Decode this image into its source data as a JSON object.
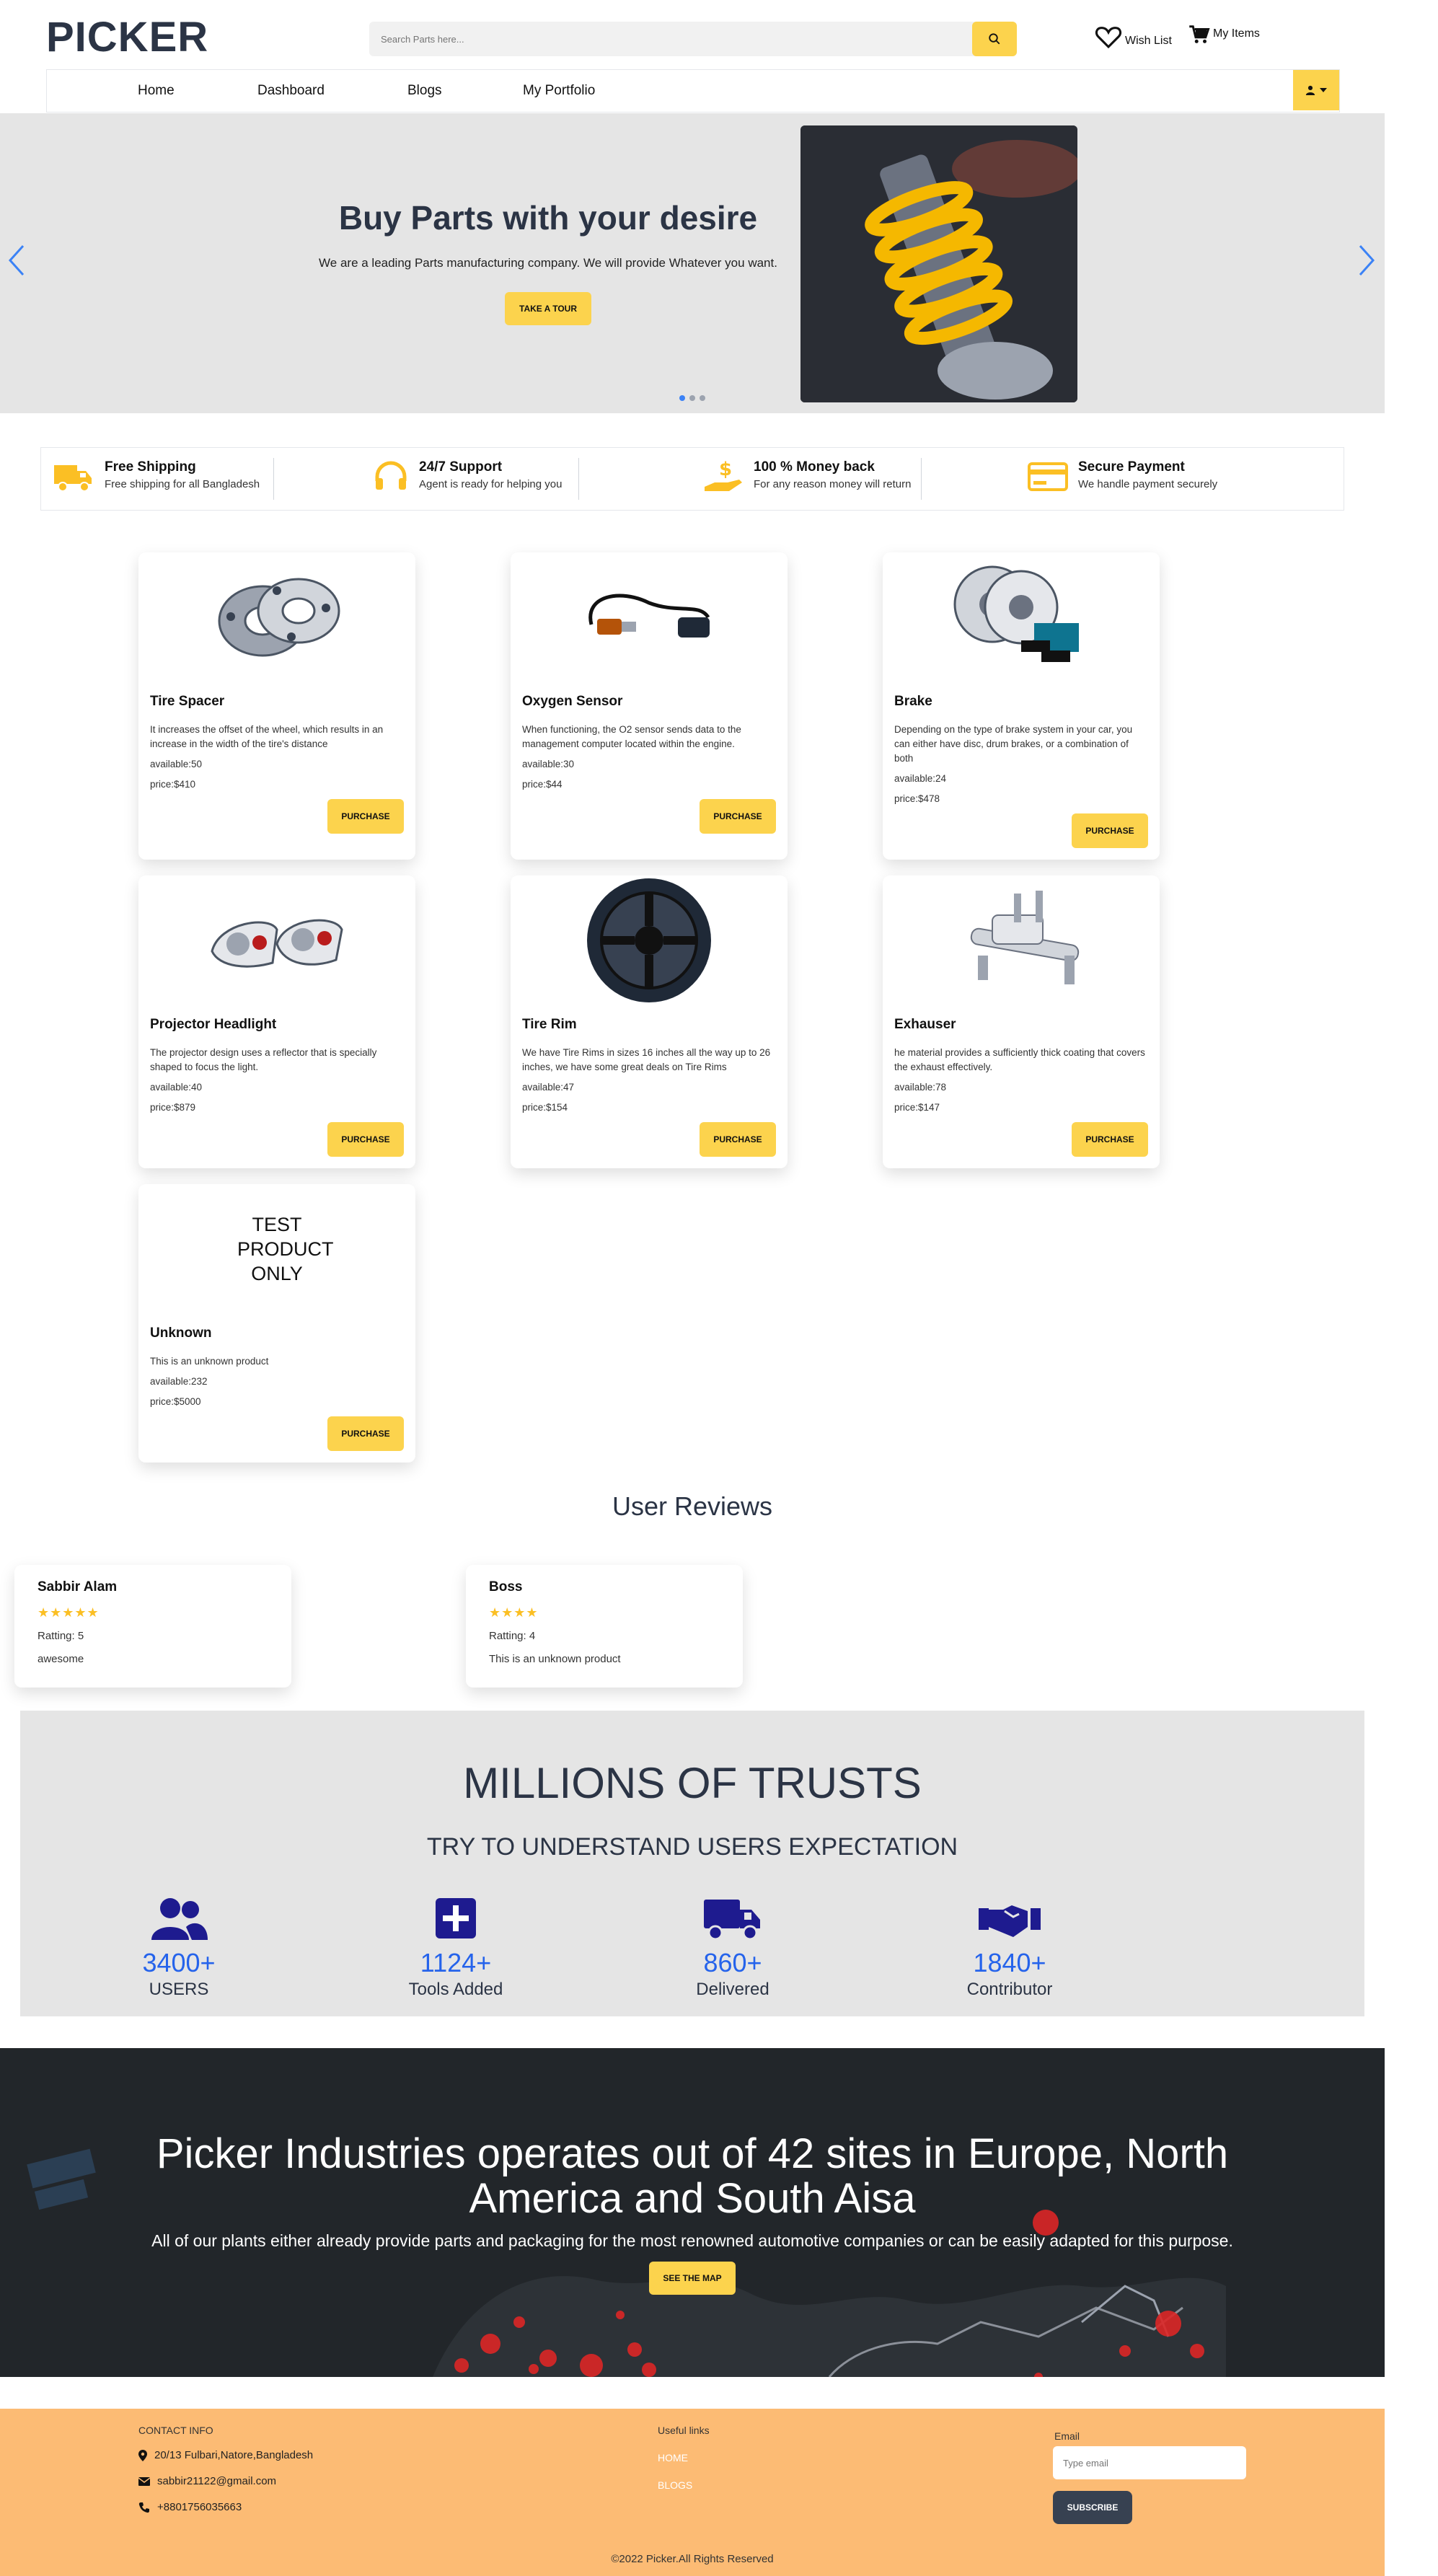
{
  "header": {
    "logo": "PICKER",
    "search_placeholder": "Search Parts here...",
    "wishlist_label": "Wish List",
    "myitems_label": "My Items"
  },
  "nav": {
    "items": [
      "Home",
      "Dashboard",
      "Blogs",
      "My Portfolio"
    ]
  },
  "hero": {
    "title": "Buy Parts with your desire",
    "subtitle": "We are a leading Parts manufacturing company. We will provide Whatever you want.",
    "button": "TAKE A TOUR",
    "active_slide": 1,
    "slide_count": 3
  },
  "features": [
    {
      "icon": "truck-icon",
      "title": "Free Shipping",
      "subtitle": "Free shipping for all Bangladesh"
    },
    {
      "icon": "headphones-icon",
      "title": "24/7 Support",
      "subtitle": "Agent is ready for helping you"
    },
    {
      "icon": "money-hand-icon",
      "title": "100 % Money back",
      "subtitle": "For any reason money will return"
    },
    {
      "icon": "credit-card-icon",
      "title": "Secure Payment",
      "subtitle": "We handle payment securely"
    }
  ],
  "products": [
    {
      "name": "Tire Spacer",
      "description": "It increases the offset of the wheel, which results in an increase in the width of the tire's distance",
      "available": "available:50",
      "price": "price:$410",
      "button": "PURCHASE",
      "image": "tire-spacer-image"
    },
    {
      "name": "Oxygen Sensor",
      "description": "When functioning, the O2 sensor sends data to the management computer located within the engine.",
      "available": "available:30",
      "price": "price:$44",
      "button": "PURCHASE",
      "image": "oxygen-sensor-image"
    },
    {
      "name": "Brake",
      "description": "Depending on the type of brake system in your car, you can either have disc, drum brakes, or a combination of both",
      "available": "available:24",
      "price": "price:$478",
      "button": "PURCHASE",
      "image": "brake-image"
    },
    {
      "name": "Projector Headlight",
      "description": "The projector design uses a reflector that is specially shaped to focus the light.",
      "available": "available:40",
      "price": "price:$879",
      "button": "PURCHASE",
      "image": "headlight-image"
    },
    {
      "name": "Tire Rim",
      "description": "We have Tire Rims in sizes 16 inches all the way up to 26 inches, we have some great deals on Tire Rims",
      "available": "available:47",
      "price": "price:$154",
      "button": "PURCHASE",
      "image": "tire-rim-image"
    },
    {
      "name": "Exhauser",
      "description": "he material provides a sufficiently thick coating that covers the exhaust effectively.",
      "available": "available:78",
      "price": "price:$147",
      "button": "PURCHASE",
      "image": "exhauser-image"
    },
    {
      "name": "Unknown",
      "description": "This is an unknown product",
      "available": "available:232",
      "price": "price:$5000",
      "button": "PURCHASE",
      "image_text": "TEST PRODUCT ONLY"
    }
  ],
  "reviews": {
    "heading": "User Reviews",
    "items": [
      {
        "name": "Sabbir Alam",
        "stars": "★★★★★",
        "rating": "Ratting: 5",
        "text": "awesome"
      },
      {
        "name": "Boss",
        "stars": "★★★★",
        "rating": "Ratting: 4",
        "text": "This is an unknown product"
      }
    ]
  },
  "trust": {
    "title": "MILLIONS OF TRUSTS",
    "subtitle": "TRY TO UNDERSTAND USERS EXPECTATION",
    "stats": [
      {
        "icon": "users-icon",
        "number": "3400+",
        "label": "USERS"
      },
      {
        "icon": "plus-square-icon",
        "number": "1124+",
        "label": "Tools Added"
      },
      {
        "icon": "delivery-truck-icon",
        "number": "860+",
        "label": "Delivered"
      },
      {
        "icon": "handshake-icon",
        "number": "1840+",
        "label": "Contributor"
      }
    ],
    "accent_color": "#2563eb",
    "icon_color": "#1e1b8f"
  },
  "map_banner": {
    "title": "Picker Industries operates out of 42 sites in Europe, North America and South Aisa",
    "subtitle": "All of our plants either already provide parts and packaging for the most renowned automotive companies or can be easily adapted for this purpose.",
    "button": "SEE THE MAP"
  },
  "footer": {
    "contact_heading": "CONTACT INFO",
    "address": "20/13 Fulbari,Natore,Bangladesh",
    "email": "sabbir21122@gmail.com",
    "phone": "+8801756035663",
    "links_heading": "Useful links",
    "links": [
      "HOME",
      "BLOGS"
    ],
    "email_label": "Email",
    "email_placeholder": "Type email",
    "subscribe": "SUBSCRIBE",
    "copyright": "©2022 Picker.All Rights Reserved"
  },
  "colors": {
    "accent": "#fcd34d",
    "footer_bg": "#fcbb74",
    "dark": "#2b3445"
  }
}
